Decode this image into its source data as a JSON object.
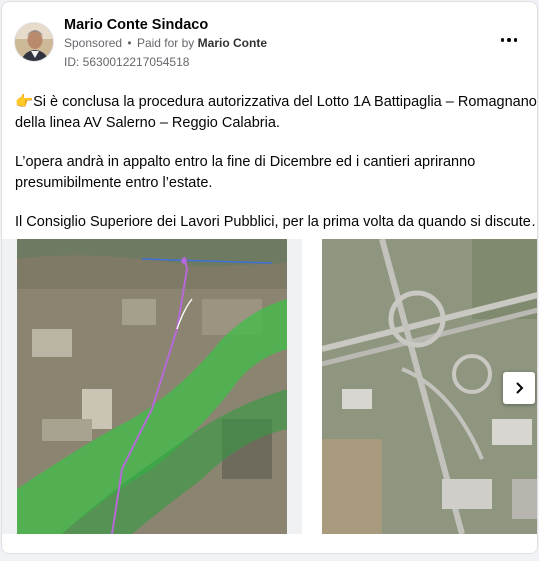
{
  "post": {
    "author_name": "Mario Conte Sindaco",
    "sponsored_label": "Sponsored",
    "separator": "•",
    "paid_for_prefix": "Paid for by",
    "paid_for_name": "Mario Conte",
    "id_line": "ID: 5630012217054518",
    "more_icon": "more-horizontal-icon"
  },
  "body": {
    "paragraph_1_emoji": "👉",
    "paragraph_1_line_1": "Si è conclusa la procedura autorizzativa del Lotto 1A Battipaglia – Romagnano",
    "paragraph_1_line_2": "della linea AV Salerno – Reggio Calabria.",
    "paragraph_2_line_1": "L’opera andrà in appalto entro la fine di Dicembre ed i cantieri apriranno",
    "paragraph_2_line_2": "presumibilmente entro l’estate.",
    "paragraph_3_line_1": "Il Consiglio Superiore dei Lavori Pubblici, per la prima volta da quando si discute…"
  },
  "carousel": {
    "slides": [
      {
        "icon": "map-route-image"
      },
      {
        "icon": "highway-aerial-image"
      }
    ],
    "next_icon": "chevron-right-icon"
  },
  "colors": {
    "route_line": "#b56ad8",
    "river_band": "#3fbf4a",
    "text_secondary": "#65676b"
  }
}
